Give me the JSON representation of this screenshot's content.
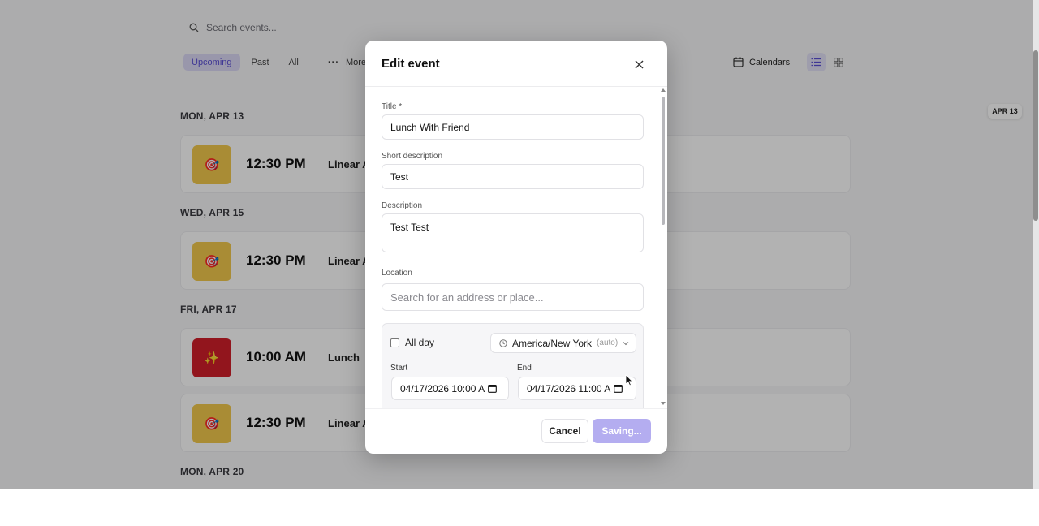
{
  "toolbar": {
    "search_placeholder": "Search events...",
    "tabs": [
      "Upcoming",
      "Past",
      "All"
    ],
    "more_label": "More",
    "calendars_label": "Calendars",
    "date_indicator": "APR 13"
  },
  "events": {
    "days": [
      "MON, APR 13",
      "WED, APR 15",
      "FRI, APR 17",
      "MON, APR 20"
    ],
    "items": [
      {
        "time": "12:30 PM",
        "title": "Linear A",
        "icon": "target-icon",
        "color": "#f2c94c"
      },
      {
        "time": "12:30 PM",
        "title": "Linear A",
        "icon": "target-icon",
        "color": "#f2c94c"
      },
      {
        "time": "10:00 AM",
        "title": "Lunch",
        "icon": "sparkle-icon",
        "color": "#d11f2a"
      },
      {
        "time": "12:30 PM",
        "title": "Linear A",
        "icon": "target-icon",
        "color": "#f2c94c"
      }
    ]
  },
  "modal": {
    "title": "Edit event",
    "fields": {
      "title_label": "Title *",
      "title_value": "Lunch With Friend",
      "short_desc_label": "Short description",
      "short_desc_value": "Test",
      "desc_label": "Description",
      "desc_value": "Test Test",
      "location_label": "Location",
      "location_placeholder": "Search for an address or place..."
    },
    "dates": {
      "all_day_label": "All day",
      "timezone": "America/New York",
      "timezone_note": "(auto)",
      "start_label": "Start",
      "start_value": "04/17/2026 10:00 A",
      "end_label": "End",
      "end_value": "04/17/2026 11:00 A"
    },
    "cancel_label": "Cancel",
    "save_label": "Saving..."
  },
  "colors": {
    "accent": "#5b4fd6",
    "accent_soft": "#b4adf0"
  }
}
